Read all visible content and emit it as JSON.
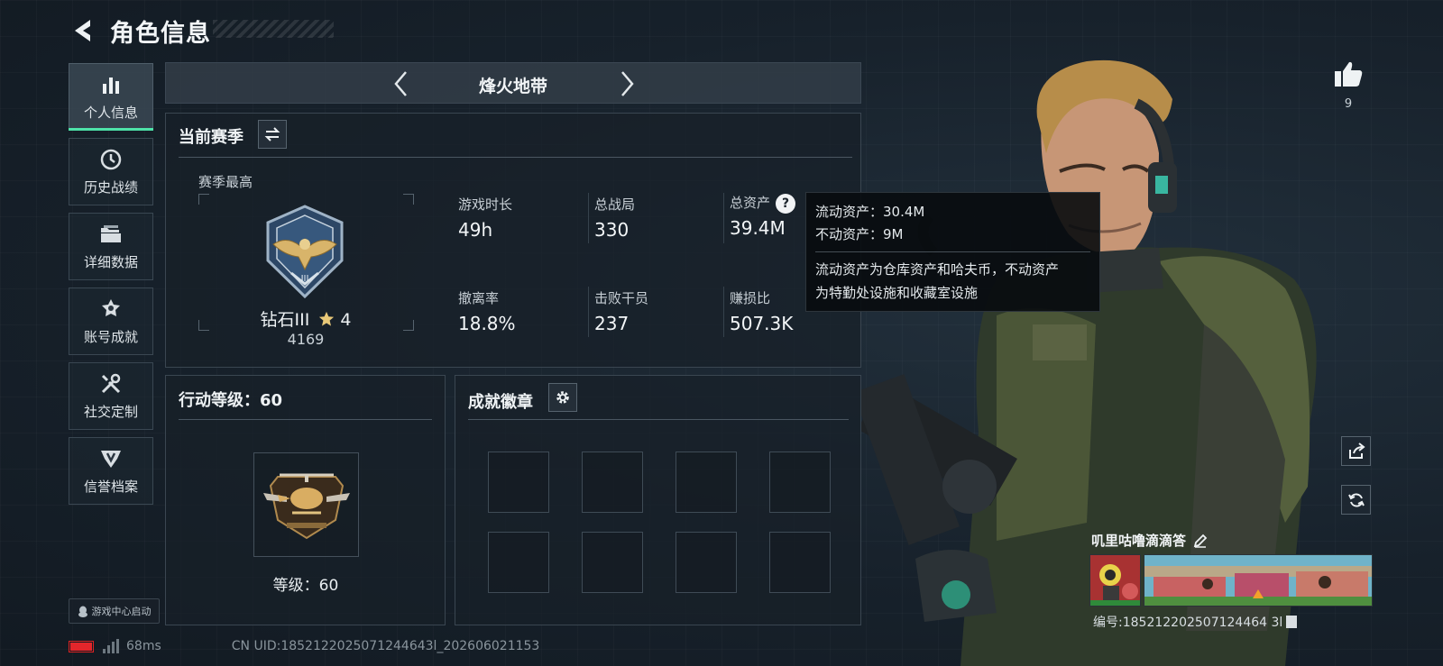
{
  "header": {
    "title": "角色信息"
  },
  "sidebar": {
    "items": [
      {
        "label": "个人信息",
        "icon": "bar-chart-icon",
        "active": true
      },
      {
        "label": "历史战绩",
        "icon": "clock-icon",
        "active": false
      },
      {
        "label": "详细数据",
        "icon": "folder-icon",
        "active": false
      },
      {
        "label": "账号成就",
        "icon": "medal-icon",
        "active": false
      },
      {
        "label": "社交定制",
        "icon": "tools-icon",
        "active": false
      },
      {
        "label": "信誉档案",
        "icon": "shield-badge-icon",
        "active": false
      }
    ],
    "launch_label": "游戏中心启动"
  },
  "map_selector": {
    "name": "烽火地带"
  },
  "season_panel": {
    "title": "当前赛季",
    "best_label": "赛季最高",
    "rank_name": "钻石III",
    "rank_stars": "4",
    "rank_score": "4169",
    "stats": [
      {
        "label": "游戏时长",
        "value": "49h"
      },
      {
        "label": "总战局",
        "value": "330"
      },
      {
        "label": "总资产",
        "value": "39.4M"
      },
      {
        "label": "撤离率",
        "value": "18.8%"
      },
      {
        "label": "击败干员",
        "value": "237"
      },
      {
        "label": "赚损比",
        "value": "507.3K"
      }
    ]
  },
  "tooltip": {
    "line1": "流动资产：30.4M",
    "line2": "不动资产：9M",
    "desc_line1": "流动资产为仓库资产和哈夫币，不动资产",
    "desc_line2": "为特勤处设施和收藏室设施"
  },
  "action_panel": {
    "title": "行动等级：60",
    "level_label": "等级：60"
  },
  "achievement_panel": {
    "title": "成就徽章",
    "slot_count": 8
  },
  "footer": {
    "ping": "68ms",
    "uid": "CN UID:1852122025071244643l_202606021153"
  },
  "player": {
    "like_count": "9",
    "name": "叽里咕噜滴滴答",
    "serial": "编号:185212202507124464 3l"
  },
  "colors": {
    "accent": "#4ee2a8",
    "battery": "#e2262b"
  }
}
